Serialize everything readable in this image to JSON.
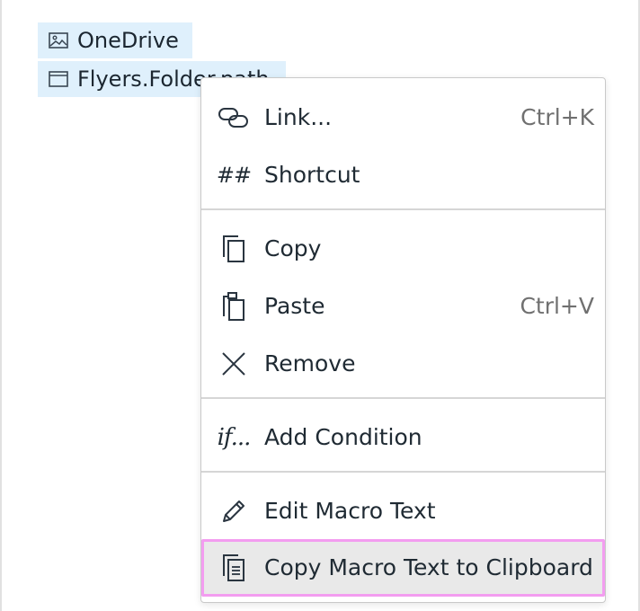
{
  "tokens": [
    {
      "label": "OneDrive",
      "icon": "image-icon"
    },
    {
      "label": "Flyers.Folder.path",
      "icon": "window-icon"
    }
  ],
  "menu": {
    "items": [
      {
        "label": "Link...",
        "shortcut": "Ctrl+K",
        "icon": "link-icon"
      },
      {
        "label": "Shortcut",
        "shortcut": "",
        "icon": "hash-icon",
        "glyph": "##"
      },
      {
        "label": "Copy",
        "shortcut": "",
        "icon": "copy-icon"
      },
      {
        "label": "Paste",
        "shortcut": "Ctrl+V",
        "icon": "paste-icon"
      },
      {
        "label": "Remove",
        "shortcut": "",
        "icon": "close-icon"
      },
      {
        "label": "Add Condition",
        "shortcut": "",
        "icon": "condition-icon",
        "glyph": "if..."
      },
      {
        "label": "Edit Macro Text",
        "shortcut": "",
        "icon": "pencil-icon"
      },
      {
        "label": "Copy Macro Text to Clipboard",
        "shortcut": "",
        "icon": "clipboard-text-icon",
        "highlighted": true
      }
    ]
  },
  "colors": {
    "token_background": "#dff0fc",
    "highlight_background": "#e9e9e9",
    "highlight_outline": "#f39df0",
    "shortcut_text": "#707070"
  }
}
